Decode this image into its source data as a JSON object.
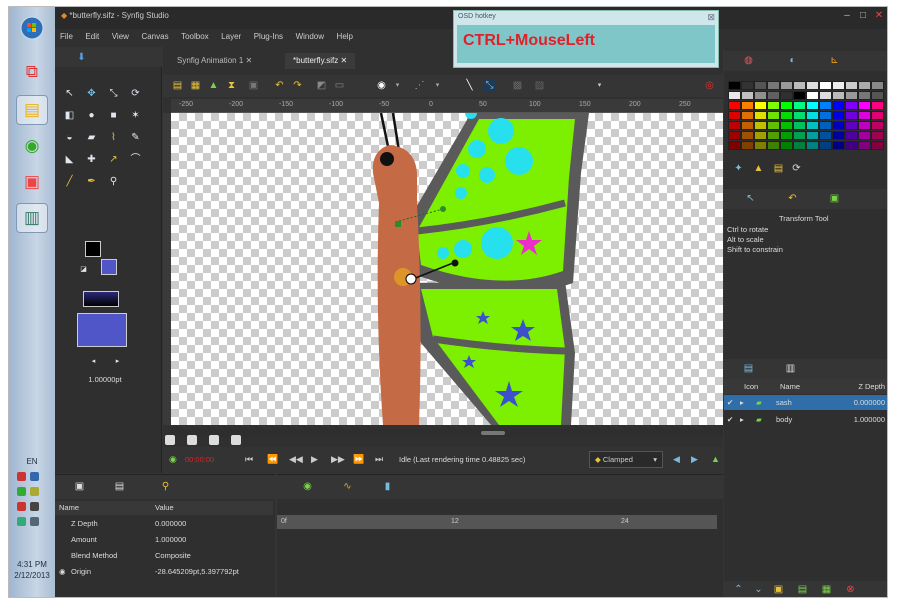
{
  "window": {
    "title": "*butterfly.sifz - Synfig Studio"
  },
  "menu": [
    "File",
    "Edit",
    "View",
    "Canvas",
    "Toolbox",
    "Layer",
    "Plug-Ins",
    "Window",
    "Help"
  ],
  "hotkey_overlay": {
    "title": "OSD hotkey",
    "text": "CTRL+MouseLeft"
  },
  "tabs": [
    {
      "label": "Synfig Animation 1"
    },
    {
      "label": "*butterfly.sifz"
    }
  ],
  "ruler_ticks": [
    "-250",
    "-200",
    "-150",
    "-100",
    "-50",
    "0",
    "50",
    "100",
    "150",
    "200",
    "250"
  ],
  "toolbox": {
    "width_value": "1.00000pt"
  },
  "playback": {
    "timecode": "00:00:00",
    "status": "Idle (Last rendering time 0.48825 sec)",
    "interpolation": "Clamped"
  },
  "params": {
    "headers": {
      "name": "Name",
      "value": "Value"
    },
    "rows": [
      {
        "name": "Z Depth",
        "value": "0.000000"
      },
      {
        "name": "Amount",
        "value": "1.000000"
      },
      {
        "name": "Blend Method",
        "value": "Composite"
      },
      {
        "name": "Origin",
        "value": "-28.645209pt,5.397792pt"
      }
    ]
  },
  "timeline_ticks": [
    "0f",
    "12",
    "24"
  ],
  "tool_options": {
    "title": "Transform Tool",
    "lines": [
      "Ctrl to rotate",
      "Alt to scale",
      "Shift to constrain"
    ]
  },
  "layers": {
    "headers": {
      "icon": "Icon",
      "name": "Name",
      "zdepth": "Z Depth"
    },
    "rows": [
      {
        "name": "sash",
        "zdepth": "0.000000",
        "selected": true
      },
      {
        "name": "body",
        "zdepth": "1.000000",
        "selected": false
      }
    ]
  },
  "taskbar": {
    "clock_time": "4:31 PM",
    "clock_date": "2/12/2013",
    "tray_label": "EN"
  },
  "colors": {
    "accent": "#2f6ea8",
    "wing": "#7cf000",
    "body": "#c46a45"
  }
}
